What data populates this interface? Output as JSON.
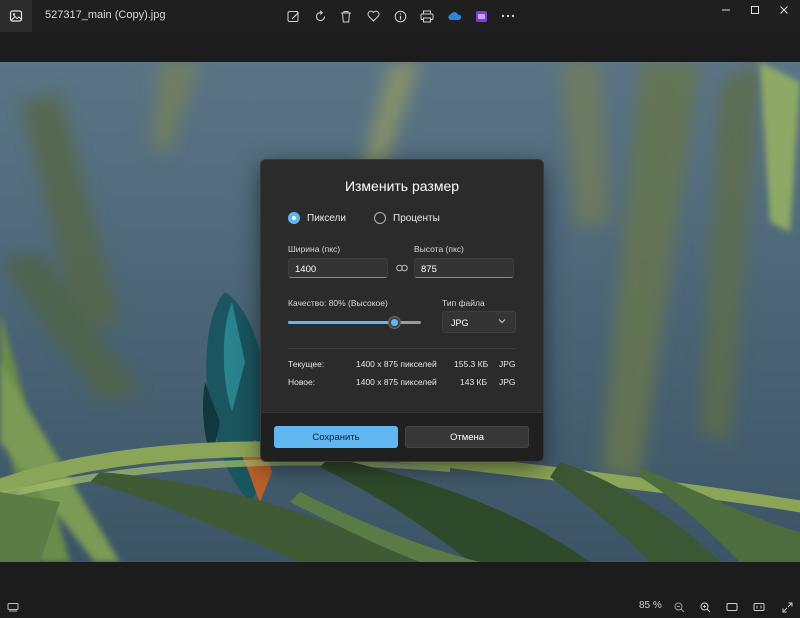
{
  "titlebar": {
    "file_name": "527317_main (Copy).jpg",
    "tools": [
      "edit-image-icon",
      "rotate-icon",
      "delete-icon",
      "favorite-icon",
      "info-icon",
      "print-icon",
      "onedrive-icon",
      "clipchamp-icon",
      "more-icon"
    ],
    "window_controls": [
      "minimize",
      "maximize",
      "close"
    ]
  },
  "dialog": {
    "title": "Изменить размер",
    "radio_pixels": "Пиксели",
    "radio_percent": "Проценты",
    "width_label": "Ширина (пкс)",
    "height_label": "Высота (пкс)",
    "width_value": "1400",
    "height_value": "875",
    "quality_label": "Качество: 80% (Высокое)",
    "quality_value": 0.8,
    "filetype_label": "Тип файла",
    "filetype_value": "JPG",
    "current_label": "Текущее:",
    "current_dims": "1400 x 875 пикселей",
    "current_size": "155.3 КБ",
    "current_type": "JPG",
    "new_label": "Новое:",
    "new_dims": "1400 x 875 пикселей",
    "new_size": "143 КБ",
    "new_type": "JPG",
    "save_label": "Сохранить",
    "cancel_label": "Отмена",
    "accent_color": "#60b6f0"
  },
  "statusbar": {
    "zoom": "85 %"
  }
}
